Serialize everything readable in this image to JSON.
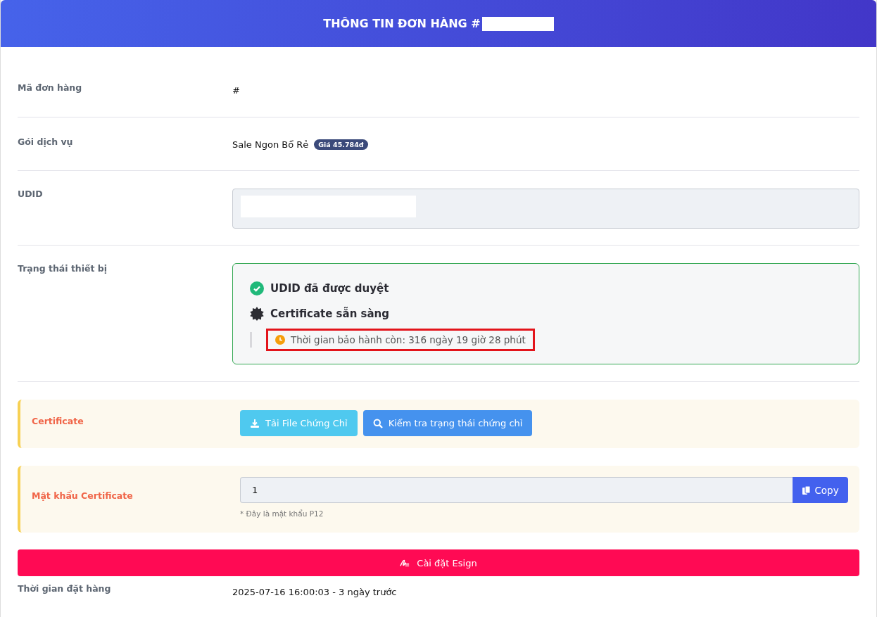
{
  "header": {
    "title": "THÔNG TIN ĐƠN HÀNG #"
  },
  "order": {
    "label": "Mã đơn hàng",
    "value": "#"
  },
  "package": {
    "label": "Gói dịch vụ",
    "name": "Sale Ngon Bổ Rẻ",
    "price_badge": "Giá 45.784đ"
  },
  "udid": {
    "label": "UDID"
  },
  "device_status": {
    "label": "Trạng thái thiết bị",
    "items": [
      {
        "kind": "approved",
        "text": "UDID đã được duyệt"
      },
      {
        "kind": "ready",
        "text": "Certificate sẵn sàng"
      }
    ],
    "warranty": {
      "text": "Thời gian bảo hành còn: 316 ngày 19 giờ 28 phút",
      "highlighted": true
    }
  },
  "certificate": {
    "label": "Certificate",
    "buttons": [
      {
        "kind": "download",
        "label": "Tải File Chứng Chỉ"
      },
      {
        "kind": "search",
        "label": "Kiểm tra trạng thái chứng chỉ"
      }
    ]
  },
  "password": {
    "label": "Mật khẩu Certificate",
    "value": "1",
    "copy_label": "Copy",
    "hint": "* Đây là mật khẩu P12"
  },
  "install_button": {
    "label": "Cài đặt Esign"
  },
  "order_time": {
    "label": "Thời gian đặt hàng",
    "value": "2025-07-16 16:00:03 - 3 ngày trước"
  }
}
